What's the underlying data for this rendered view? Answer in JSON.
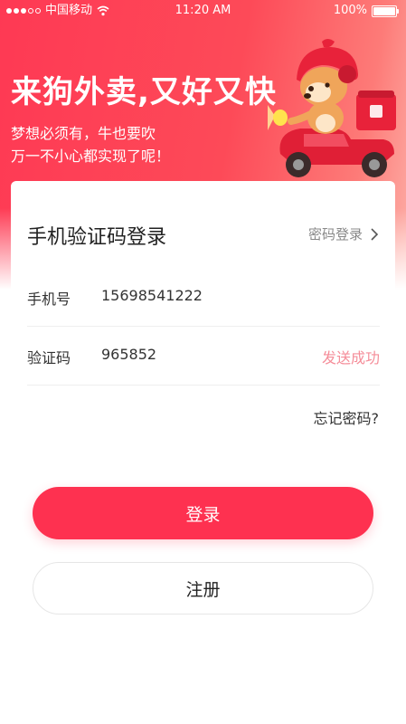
{
  "status_bar": {
    "carrier": "中国移动",
    "time": "11:20 AM",
    "battery": "100%",
    "signal_icon": "signal-dots-icon",
    "wifi_icon": "wifi-icon",
    "battery_icon": "battery-icon"
  },
  "banner": {
    "headline": "来狗外卖,又好又快",
    "subline1": "梦想必须有，牛也要吹",
    "subline2": "万一不小心都实现了呢！",
    "illustration": "delivery-dog-scooter-illustration"
  },
  "login": {
    "title": "手机验证码登录",
    "password_login": "密码登录",
    "phone_label": "手机号",
    "phone_value": "15698541222",
    "code_label": "验证码",
    "code_value": "965852",
    "send_status": "发送成功",
    "forgot_password": "忘记密码?"
  },
  "actions": {
    "login_button": "登录",
    "register_button": "注册"
  },
  "colors": {
    "brand_red": "#fe3150",
    "send_status": "#f58d99"
  }
}
